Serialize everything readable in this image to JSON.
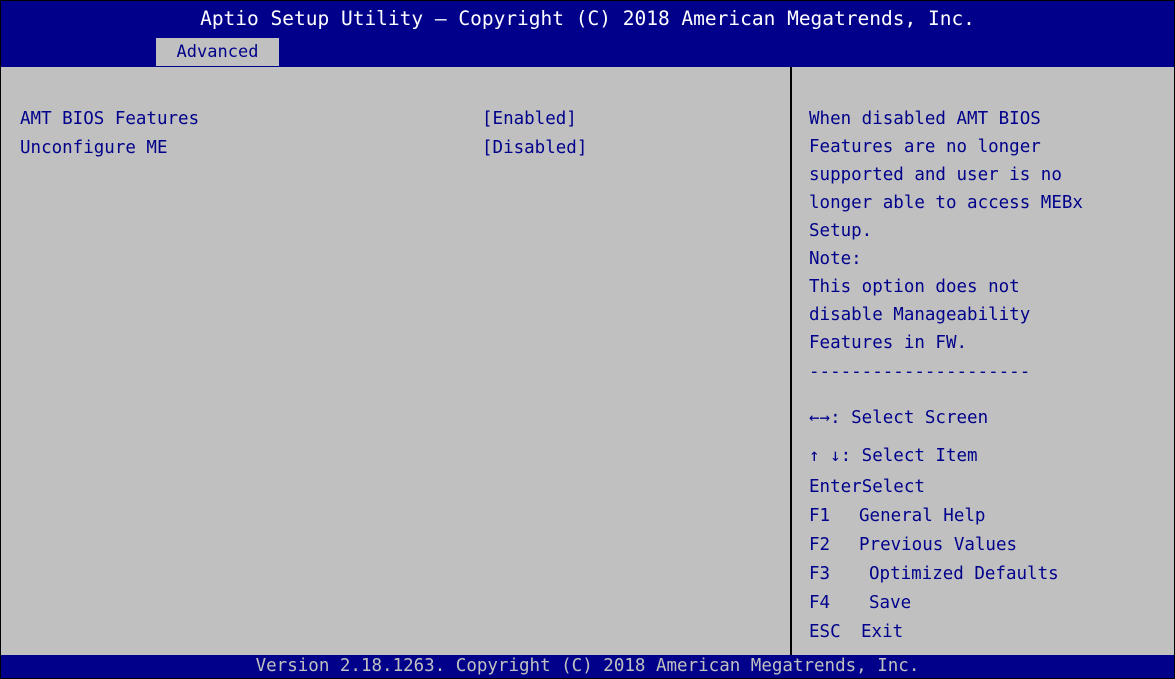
{
  "header": {
    "title": "Aptio Setup Utility – Copyright (C) 2018 American Megatrends, Inc.",
    "tabs": [
      {
        "label": "Advanced",
        "active": true
      }
    ]
  },
  "settings": [
    {
      "label": "AMT BIOS Features",
      "value": "[Enabled]"
    },
    {
      "label": "Unconfigure ME",
      "value": "[Disabled]"
    }
  ],
  "help": {
    "lines": [
      "When disabled AMT BIOS",
      "Features are no longer",
      "supported and user is no",
      "longer able to access MEBx",
      "Setup.",
      "Note:",
      "This option does not",
      "disable Manageability",
      "Features in FW."
    ],
    "separator": "---------------------"
  },
  "keys": [
    {
      "key": "←→",
      "action": ": Select Screen"
    },
    {
      "key": "↑ ↓",
      "action": ": Select Item"
    },
    {
      "key": "Enter",
      "action": "Select"
    },
    {
      "key": "F1",
      "action": "General Help"
    },
    {
      "key": "F2",
      "action": "Previous Values"
    },
    {
      "key": "F3",
      "action": "Optimized Defaults"
    },
    {
      "key": "F4",
      "action": "Save"
    },
    {
      "key": "ESC",
      "action": "Exit"
    }
  ],
  "footer": {
    "text": "Version 2.18.1263. Copyright (C) 2018 American Megatrends, Inc."
  },
  "colors": {
    "background": "#c0c0c0",
    "header_bar": "#00008b",
    "text": "#00008b",
    "header_text": "#ffffff",
    "footer_text": "#c0c0c0"
  }
}
